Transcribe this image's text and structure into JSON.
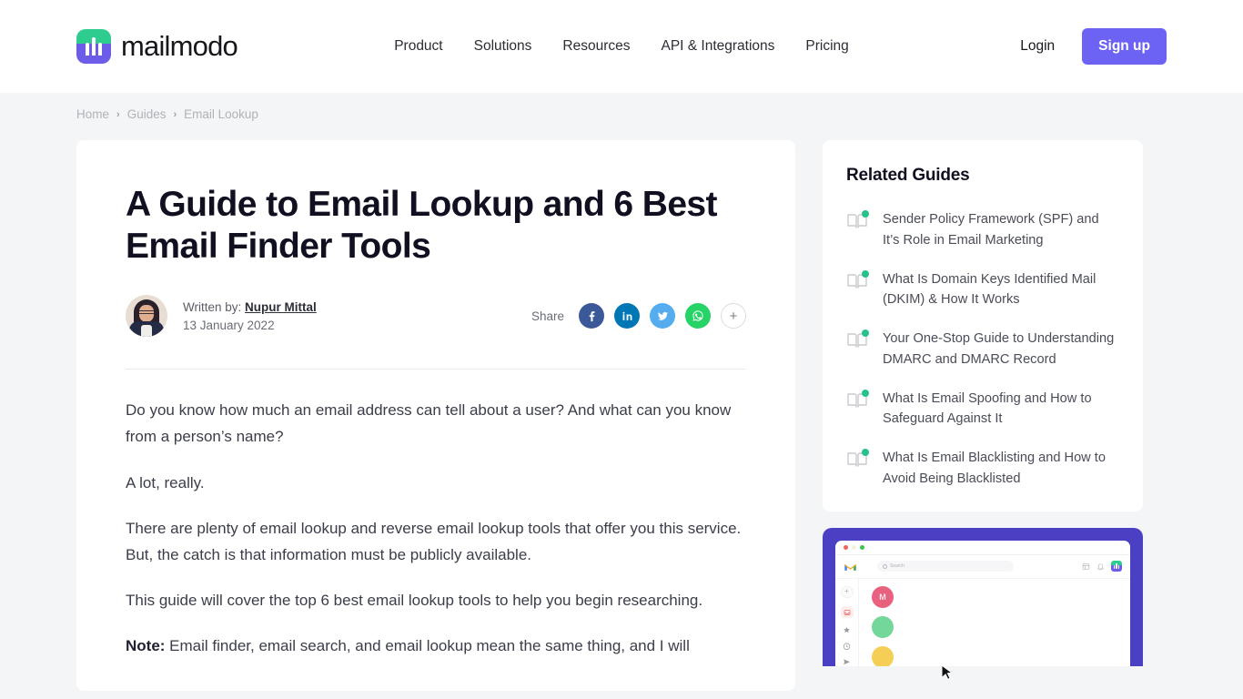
{
  "header": {
    "brand": "mailmodo",
    "nav": [
      {
        "label": "Product"
      },
      {
        "label": "Solutions"
      },
      {
        "label": "Resources"
      },
      {
        "label": "API & Integrations"
      },
      {
        "label": "Pricing"
      }
    ],
    "login_label": "Login",
    "signup_label": "Sign up",
    "accent_color": "#6c63f5"
  },
  "breadcrumb": {
    "items": [
      "Home",
      "Guides",
      "Email Lookup"
    ],
    "separator": "›"
  },
  "article": {
    "title": "A Guide to Email Lookup and 6 Best Email Finder Tools",
    "written_by_label": "Written by:",
    "author": "Nupur Mittal",
    "date": "13 January 2022",
    "share_label": "Share",
    "share_buttons": [
      {
        "name": "facebook",
        "color": "#3b5998"
      },
      {
        "name": "linkedin",
        "color": "#0077b5"
      },
      {
        "name": "twitter",
        "color": "#55acee"
      },
      {
        "name": "whatsapp",
        "color": "#25d366"
      },
      {
        "name": "more",
        "label": "+"
      }
    ],
    "paragraphs": [
      {
        "text": "Do you know how much an email address can tell about a user? And what can you know from a person’s name?"
      },
      {
        "text": "A lot, really."
      },
      {
        "text": "There are plenty of email lookup and reverse email lookup tools that offer you this service. But, the catch is that information must be publicly available."
      },
      {
        "text": "This guide will cover the top 6 best email lookup tools to help you begin researching."
      }
    ],
    "note_label": "Note:",
    "note_text": " Email finder, email search, and email lookup mean the same thing, and I will"
  },
  "related": {
    "title": "Related Guides",
    "items": [
      {
        "label": "Sender Policy Framework (SPF) and It’s Role in Email Marketing"
      },
      {
        "label": "What Is Domain Keys Identified Mail (DKIM) & How It Works"
      },
      {
        "label": "Your One-Stop Guide to Understanding DMARC and DMARC Record"
      },
      {
        "label": "What Is Email Spoofing and How to Safeguard Against It"
      },
      {
        "label": "What Is Email Blacklisting and How to Avoid Being Blacklisted"
      }
    ],
    "badge_color": "#27c28a"
  },
  "promo": {
    "card_color": "#4b3fc4",
    "mock": {
      "search_placeholder": "Search",
      "rows": [
        {
          "initial": "M",
          "color": "#e8627f"
        },
        {
          "initial": "",
          "color": "#74d79a"
        },
        {
          "initial": "",
          "color": "#f5ce55"
        }
      ]
    }
  }
}
